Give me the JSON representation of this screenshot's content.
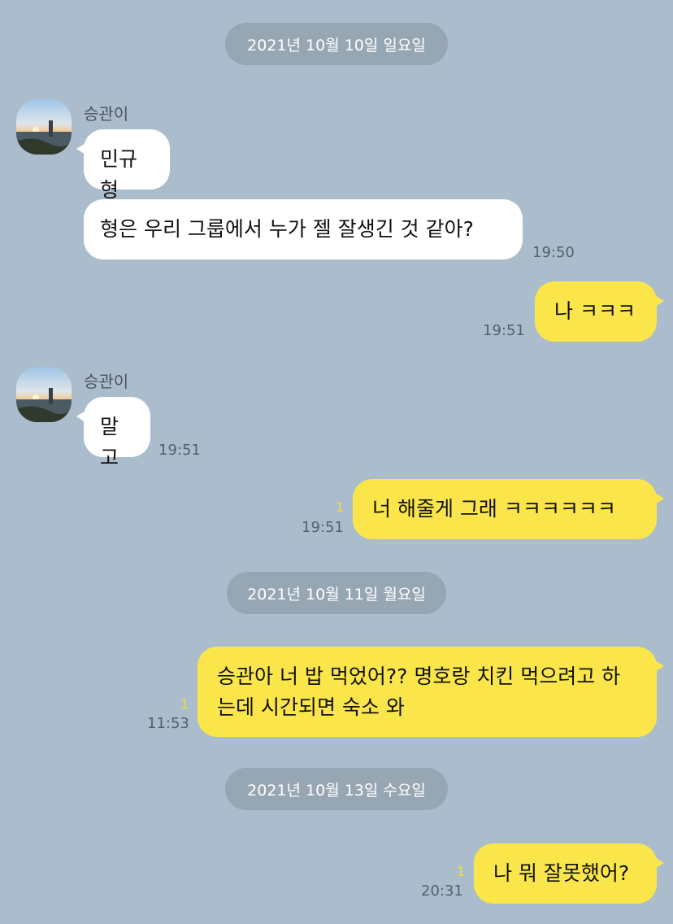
{
  "dates": [
    "2021년 10월 10일 일요일",
    "2021년 10월 11일 월요일",
    "2021년 10월 13일 수요일"
  ],
  "sender_name": "승관이",
  "messages": [
    {
      "dir": "in",
      "text": "민규형"
    },
    {
      "dir": "in",
      "text": "형은 우리 그룹에서 누가 젤 잘생긴 것 같아?",
      "time": "19:50"
    },
    {
      "dir": "out",
      "text": "나 ㅋㅋㅋ",
      "time": "19:51"
    },
    {
      "dir": "in",
      "text": "말고",
      "time": "19:51"
    },
    {
      "dir": "out",
      "text": "너 해줄게 그래 ㅋㅋㅋㅋㅋㅋ",
      "time": "19:51",
      "unread": "1"
    },
    {
      "dir": "out",
      "text": "승관아 너 밥 먹었어?? 명호랑 치킨 먹으려고 하는데 시간되면 숙소 와",
      "time": "11:53",
      "unread": "1"
    },
    {
      "dir": "out",
      "text": "나 뭐 잘못했어?",
      "time": "20:31",
      "unread": "1"
    }
  ],
  "colors": {
    "background": "#abbdcd",
    "incoming_bubble": "#ffffff",
    "outgoing_bubble": "#fae64a",
    "date_pill": "#97a6b3",
    "unread": "#f5df2d"
  },
  "icons": {
    "avatar": "avatar-sunset-photo"
  }
}
